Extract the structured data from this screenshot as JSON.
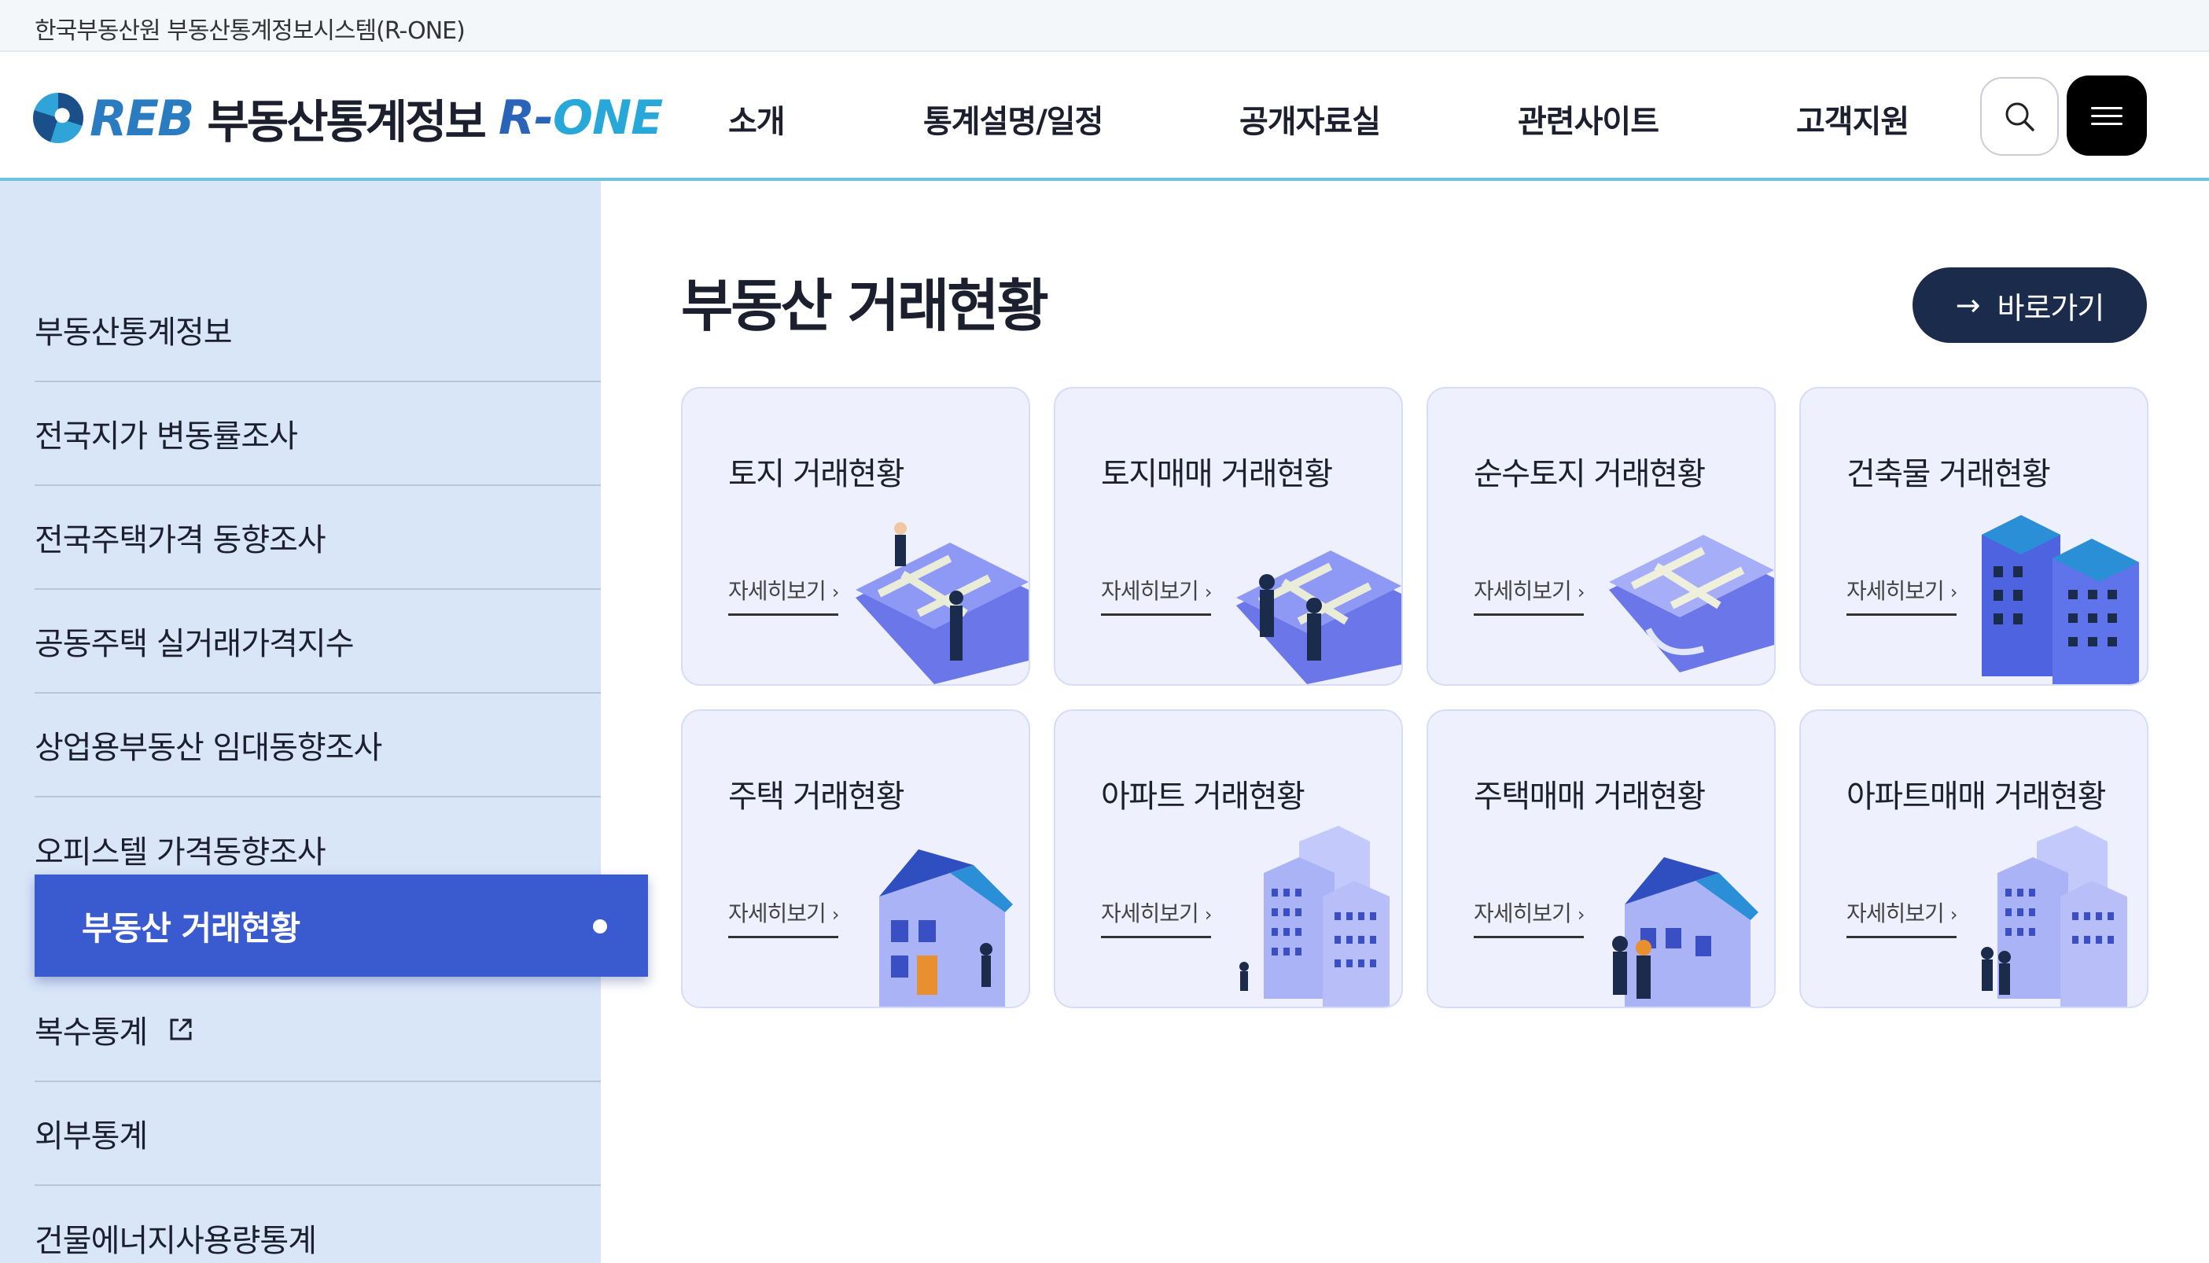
{
  "topbar": {
    "text": "한국부동산원 부동산통계정보시스템(R-ONE)"
  },
  "header": {
    "logo_reb": "REB",
    "logo_title": "부동산통계정보",
    "logo_rone_r": "R-",
    "logo_rone_one": "ONE",
    "nav": [
      "소개",
      "통계설명/일정",
      "공개자료실",
      "관련사이트",
      "고객지원"
    ]
  },
  "sidebar": {
    "items": [
      "부동산통계정보",
      "전국지가 변동률조사",
      "전국주택가격 동향조사",
      "공동주택 실거래가격지수",
      "상업용부동산 임대동향조사",
      "오피스텔 가격동향조사",
      "부동산 거래현황",
      "복수통계",
      "외부통계",
      "건물에너지사용량통계"
    ],
    "active_index": 6
  },
  "main": {
    "title": "부동산 거래현황",
    "goto_label": "바로가기",
    "more_label": "자세히보기",
    "cards": [
      "토지 거래현황",
      "토지매매 거래현황",
      "순수토지 거래현황",
      "건축물 거래현황",
      "주택 거래현황",
      "아파트 거래현황",
      "주택매매 거래현황",
      "아파트매매 거래현황"
    ]
  },
  "colors": {
    "accent": "#3a5ad0",
    "sidebar_bg": "#d9e6f8",
    "card_bg": "#eef1fd",
    "goto_bg": "#1b2b4b",
    "header_line": "#6cc3dc"
  },
  "icons": [
    "search-icon",
    "menu-icon",
    "arrow-right-icon",
    "external-link-icon",
    "chevron-right-icon"
  ]
}
